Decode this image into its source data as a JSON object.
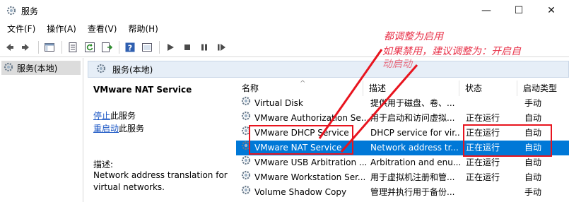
{
  "window": {
    "title": "服务",
    "minimize_glyph": "—",
    "maximize_glyph": "☐",
    "close_glyph": "✕"
  },
  "menu": [
    "文件(F)",
    "操作(A)",
    "查看(V)",
    "帮助(H)"
  ],
  "tree": {
    "root_label": "服务(本地)"
  },
  "pane_header": "服务(本地)",
  "detail": {
    "service_name": "VMware NAT Service",
    "stop_link": "停止",
    "stop_suffix": "此服务",
    "restart_link": "重启动",
    "restart_suffix": "此服务",
    "desc_label": "描述:",
    "desc_text": "Network address translation for virtual networks."
  },
  "table": {
    "columns": [
      "名称",
      "描述",
      "状态",
      "启动类型"
    ],
    "sort_glyph": "^",
    "rows": [
      {
        "name": "Virtual Disk",
        "desc": "提供用于磁盘、卷、...",
        "status": "",
        "startup": "手动",
        "selected": false
      },
      {
        "name": "VMware Authorization Se...",
        "desc": "用于启动和访问虚拟...",
        "status": "正在运行",
        "startup": "自动",
        "selected": false
      },
      {
        "name": "VMware DHCP Service",
        "desc": "DHCP service for vir...",
        "status": "正在运行",
        "startup": "自动",
        "selected": false
      },
      {
        "name": "VMware NAT Service",
        "desc": "Network address tr...",
        "status": "正在运行",
        "startup": "自动",
        "selected": true
      },
      {
        "name": "VMware USB Arbitration ...",
        "desc": "Arbitration and enu...",
        "status": "正在运行",
        "startup": "自动",
        "selected": false
      },
      {
        "name": "VMware Workstation Ser...",
        "desc": "用于虚拟机注册和管...",
        "status": "正在运行",
        "startup": "自动",
        "selected": false
      },
      {
        "name": "Volume Shadow Copy",
        "desc": "管理并执行用于备份...",
        "status": "",
        "startup": "手动",
        "selected": false
      }
    ]
  },
  "annotation": {
    "line1": "都调整为启用",
    "line2": "如果禁用，建议调整为：开启自",
    "line3": "动启动",
    "color": "#e8141e"
  },
  "colors": {
    "selection": "#0078d7",
    "link": "#1a56c4",
    "header_bg": "#e6eef7"
  }
}
